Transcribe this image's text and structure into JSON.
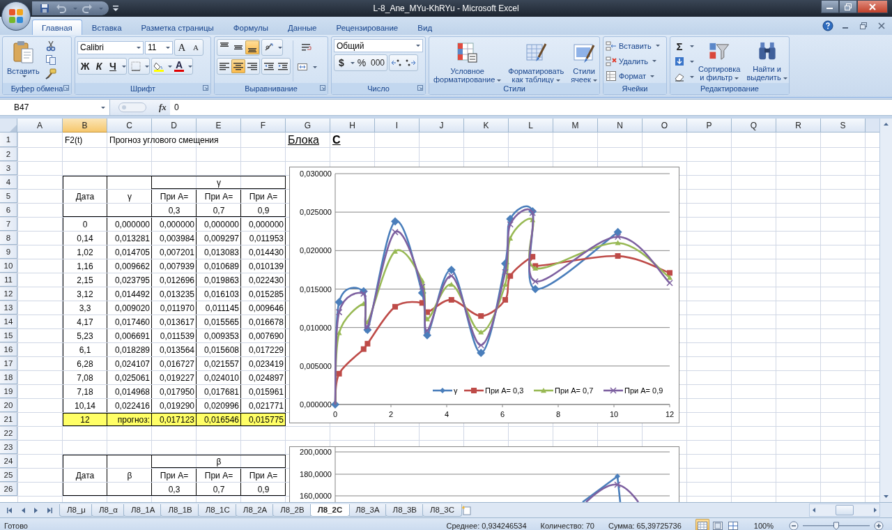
{
  "title_bar": {
    "title": "L-8_Ane_MYu-KhRYu - Microsoft Excel"
  },
  "tabs": [
    {
      "label": "Главная",
      "selected": true
    },
    {
      "label": "Вставка",
      "selected": false
    },
    {
      "label": "Разметка страницы",
      "selected": false
    },
    {
      "label": "Формулы",
      "selected": false
    },
    {
      "label": "Данные",
      "selected": false
    },
    {
      "label": "Рецензирование",
      "selected": false
    },
    {
      "label": "Вид",
      "selected": false
    }
  ],
  "ribbon": {
    "groups": [
      {
        "kind": "clipboard",
        "label": "Буфер обмена",
        "paste": "Вставить"
      },
      {
        "kind": "font",
        "label": "Шрифт",
        "font_name": "Calibri",
        "font_size": "11",
        "grow": "A",
        "shrink": "A",
        "bold": "Ж",
        "italic": "К",
        "underline": "Ч",
        "font_color": "A"
      },
      {
        "kind": "alignment",
        "label": "Выравнивание",
        "vertical": [
          {
            "selected": false
          },
          {
            "selected": false
          },
          {
            "selected": true
          }
        ],
        "horizontal": [
          {
            "selected": false
          },
          {
            "selected": true
          },
          {
            "selected": false
          }
        ]
      },
      {
        "kind": "number",
        "label": "Число",
        "format": "Общий",
        "currency": "$",
        "percent": "%",
        "thousands": "000"
      },
      {
        "kind": "styles",
        "label": "Стили",
        "buttons": [
          {
            "lines": [
              "Условное",
              "форматирование"
            ]
          },
          {
            "lines": [
              "Форматировать",
              "как таблицу"
            ]
          },
          {
            "lines": [
              "Стили",
              "ячеек"
            ]
          }
        ]
      },
      {
        "kind": "cells",
        "label": "Ячейки",
        "buttons": [
          "Вставить",
          "Удалить",
          "Формат"
        ]
      },
      {
        "kind": "editing",
        "label": "Редактирование",
        "sum": "Σ",
        "buttons": [
          {
            "lines": [
              "Сортировка",
              "и фильтр"
            ]
          },
          {
            "lines": [
              "Найти и",
              "выделить"
            ]
          }
        ]
      }
    ]
  },
  "formula_bar": {
    "name_box": "B47",
    "fx": "fx",
    "value": "0"
  },
  "sheet": {
    "columns": [
      {
        "label": "A",
        "selected": false
      },
      {
        "label": "B",
        "selected": true
      },
      {
        "label": "C",
        "selected": false
      },
      {
        "label": "D",
        "selected": false
      },
      {
        "label": "E",
        "selected": false
      },
      {
        "label": "F",
        "selected": false
      },
      {
        "label": "G",
        "selected": false
      },
      {
        "label": "H",
        "selected": false
      },
      {
        "label": "I",
        "selected": false
      },
      {
        "label": "J",
        "selected": false
      },
      {
        "label": "K",
        "selected": false
      },
      {
        "label": "L",
        "selected": false
      },
      {
        "label": "M",
        "selected": false
      },
      {
        "label": "N",
        "selected": false
      },
      {
        "label": "O",
        "selected": false
      },
      {
        "label": "P",
        "selected": false
      },
      {
        "label": "Q",
        "selected": false
      },
      {
        "label": "R",
        "selected": false
      },
      {
        "label": "S",
        "selected": false
      }
    ],
    "row_numbers": [
      "1",
      "2",
      "3",
      "4",
      "5",
      "6",
      "7",
      "8",
      "9",
      "10",
      "11",
      "12",
      "13",
      "14",
      "15",
      "16",
      "17",
      "18",
      "19",
      "20",
      "21",
      "22",
      "23",
      "24",
      "25",
      "26"
    ],
    "title_cells": [
      {
        "kind": "text",
        "text": "F2(t)"
      },
      {
        "kind": "text",
        "text": "Прогноз углового смещения"
      },
      {
        "kind": "heading",
        "text": "Блока"
      },
      {
        "kind": "heading-bold",
        "text": "C"
      }
    ],
    "tables": [
      {
        "group_header": "γ",
        "headers": [
          "Дата",
          "γ",
          "При А=",
          "При А=",
          "При А="
        ],
        "subheaders": [
          "0,3",
          "0,7",
          "0,9"
        ],
        "rows": [
          [
            "0",
            "0,000000",
            "0,000000",
            "0,000000",
            "0,000000"
          ],
          [
            "0,14",
            "0,013281",
            "0,003984",
            "0,009297",
            "0,011953"
          ],
          [
            "1,02",
            "0,014705",
            "0,007201",
            "0,013083",
            "0,014430"
          ],
          [
            "1,16",
            "0,009662",
            "0,007939",
            "0,010689",
            "0,010139"
          ],
          [
            "2,15",
            "0,023795",
            "0,012696",
            "0,019863",
            "0,022430"
          ],
          [
            "3,12",
            "0,014492",
            "0,013235",
            "0,016103",
            "0,015285"
          ],
          [
            "3,3",
            "0,009020",
            "0,011970",
            "0,011145",
            "0,009646"
          ],
          [
            "4,17",
            "0,017460",
            "0,013617",
            "0,015565",
            "0,016678"
          ],
          [
            "5,23",
            "0,006691",
            "0,011539",
            "0,009353",
            "0,007690"
          ],
          [
            "6,1",
            "0,018289",
            "0,013564",
            "0,015608",
            "0,017229"
          ],
          [
            "6,28",
            "0,024107",
            "0,016727",
            "0,021557",
            "0,023419"
          ],
          [
            "7,08",
            "0,025061",
            "0,019227",
            "0,024010",
            "0,024897"
          ],
          [
            "7,18",
            "0,014968",
            "0,017950",
            "0,017681",
            "0,015961"
          ],
          [
            "10,14",
            "0,022416",
            "0,019290",
            "0,020996",
            "0,021771"
          ]
        ],
        "forecast": [
          "12",
          "прогноз:",
          "0,017123",
          "0,016546",
          "0,015775"
        ]
      },
      {
        "group_header": "β",
        "headers": [
          "Дата",
          "β",
          "При А=",
          "При А=",
          "При А="
        ],
        "subheaders": [
          "0,3",
          "0,7",
          "0,9"
        ]
      }
    ],
    "charts": [
      {
        "chart_data": {
          "type": "line",
          "grid": true,
          "legend": "inside-bottom-right",
          "x": [
            0,
            0.14,
            1.02,
            1.16,
            2.15,
            3.12,
            3.3,
            4.17,
            5.23,
            6.1,
            6.28,
            7.08,
            7.18,
            10.14,
            12
          ],
          "xlim": [
            0,
            12
          ],
          "ylim": [
            0,
            0.03
          ],
          "xticks": [
            0,
            2,
            4,
            6,
            8,
            10,
            12
          ],
          "yticks": [
            {
              "value": 0,
              "label": "0,000000"
            },
            {
              "value": 0.005,
              "label": "0,005000"
            },
            {
              "value": 0.01,
              "label": "0,010000"
            },
            {
              "value": 0.015,
              "label": "0,015000"
            },
            {
              "value": 0.02,
              "label": "0,020000"
            },
            {
              "value": 0.025,
              "label": "0,025000"
            },
            {
              "value": 0.03,
              "label": "0,030000"
            }
          ],
          "series": [
            {
              "name": "γ",
              "color": "#4a7ebb",
              "marker": "diamond",
              "values": [
                0,
                0.0133,
                0.0147,
                0.0097,
                0.0238,
                0.0145,
                0.009,
                0.0175,
                0.0067,
                0.0183,
                0.0241,
                0.0251,
                0.015,
                0.0224,
                null
              ]
            },
            {
              "name": "При А= 0,3",
              "color": "#be4b48",
              "marker": "square",
              "values": [
                0,
                0.004,
                0.0072,
                0.0079,
                0.0127,
                0.0132,
                0.012,
                0.0136,
                0.0115,
                0.0136,
                0.0167,
                0.0192,
                0.018,
                0.0193,
                0.0171
              ]
            },
            {
              "name": "При А= 0,7",
              "color": "#98b954",
              "marker": "triangle",
              "values": [
                0,
                0.0093,
                0.0131,
                0.0107,
                0.0199,
                0.0161,
                0.0111,
                0.0156,
                0.0094,
                0.0156,
                0.0216,
                0.024,
                0.0177,
                0.021,
                0.0165
              ]
            },
            {
              "name": "При А= 0,9",
              "color": "#7d60a0",
              "marker": "x",
              "values": [
                0,
                0.012,
                0.0144,
                0.0101,
                0.0224,
                0.0153,
                0.0096,
                0.0167,
                0.0077,
                0.0172,
                0.0234,
                0.0249,
                0.016,
                0.0218,
                0.0158
              ]
            }
          ]
        }
      },
      {
        "ytick_labels": [
          "200,0000",
          "180,0000",
          "160,0000"
        ]
      }
    ]
  },
  "sheet_tabs": [
    {
      "label": "Л8_μ",
      "selected": false
    },
    {
      "label": "Л8_α",
      "selected": false
    },
    {
      "label": "Л8_1А",
      "selected": false
    },
    {
      "label": "Л8_1В",
      "selected": false
    },
    {
      "label": "Л8_1С",
      "selected": false
    },
    {
      "label": "Л8_2А",
      "selected": false
    },
    {
      "label": "Л8_2В",
      "selected": false
    },
    {
      "label": "Л8_2С",
      "selected": true
    },
    {
      "label": "Л8_3А",
      "selected": false
    },
    {
      "label": "Л8_3В",
      "selected": false
    },
    {
      "label": "Л8_3С",
      "selected": false
    }
  ],
  "status_bar": {
    "mode": "Готово",
    "average": "Среднее: 0,934246534",
    "count": "Количество: 70",
    "sum": "Сумма: 65,39725736",
    "zoom": "100%",
    "zoom_slider": {
      "level": 0.5
    }
  }
}
